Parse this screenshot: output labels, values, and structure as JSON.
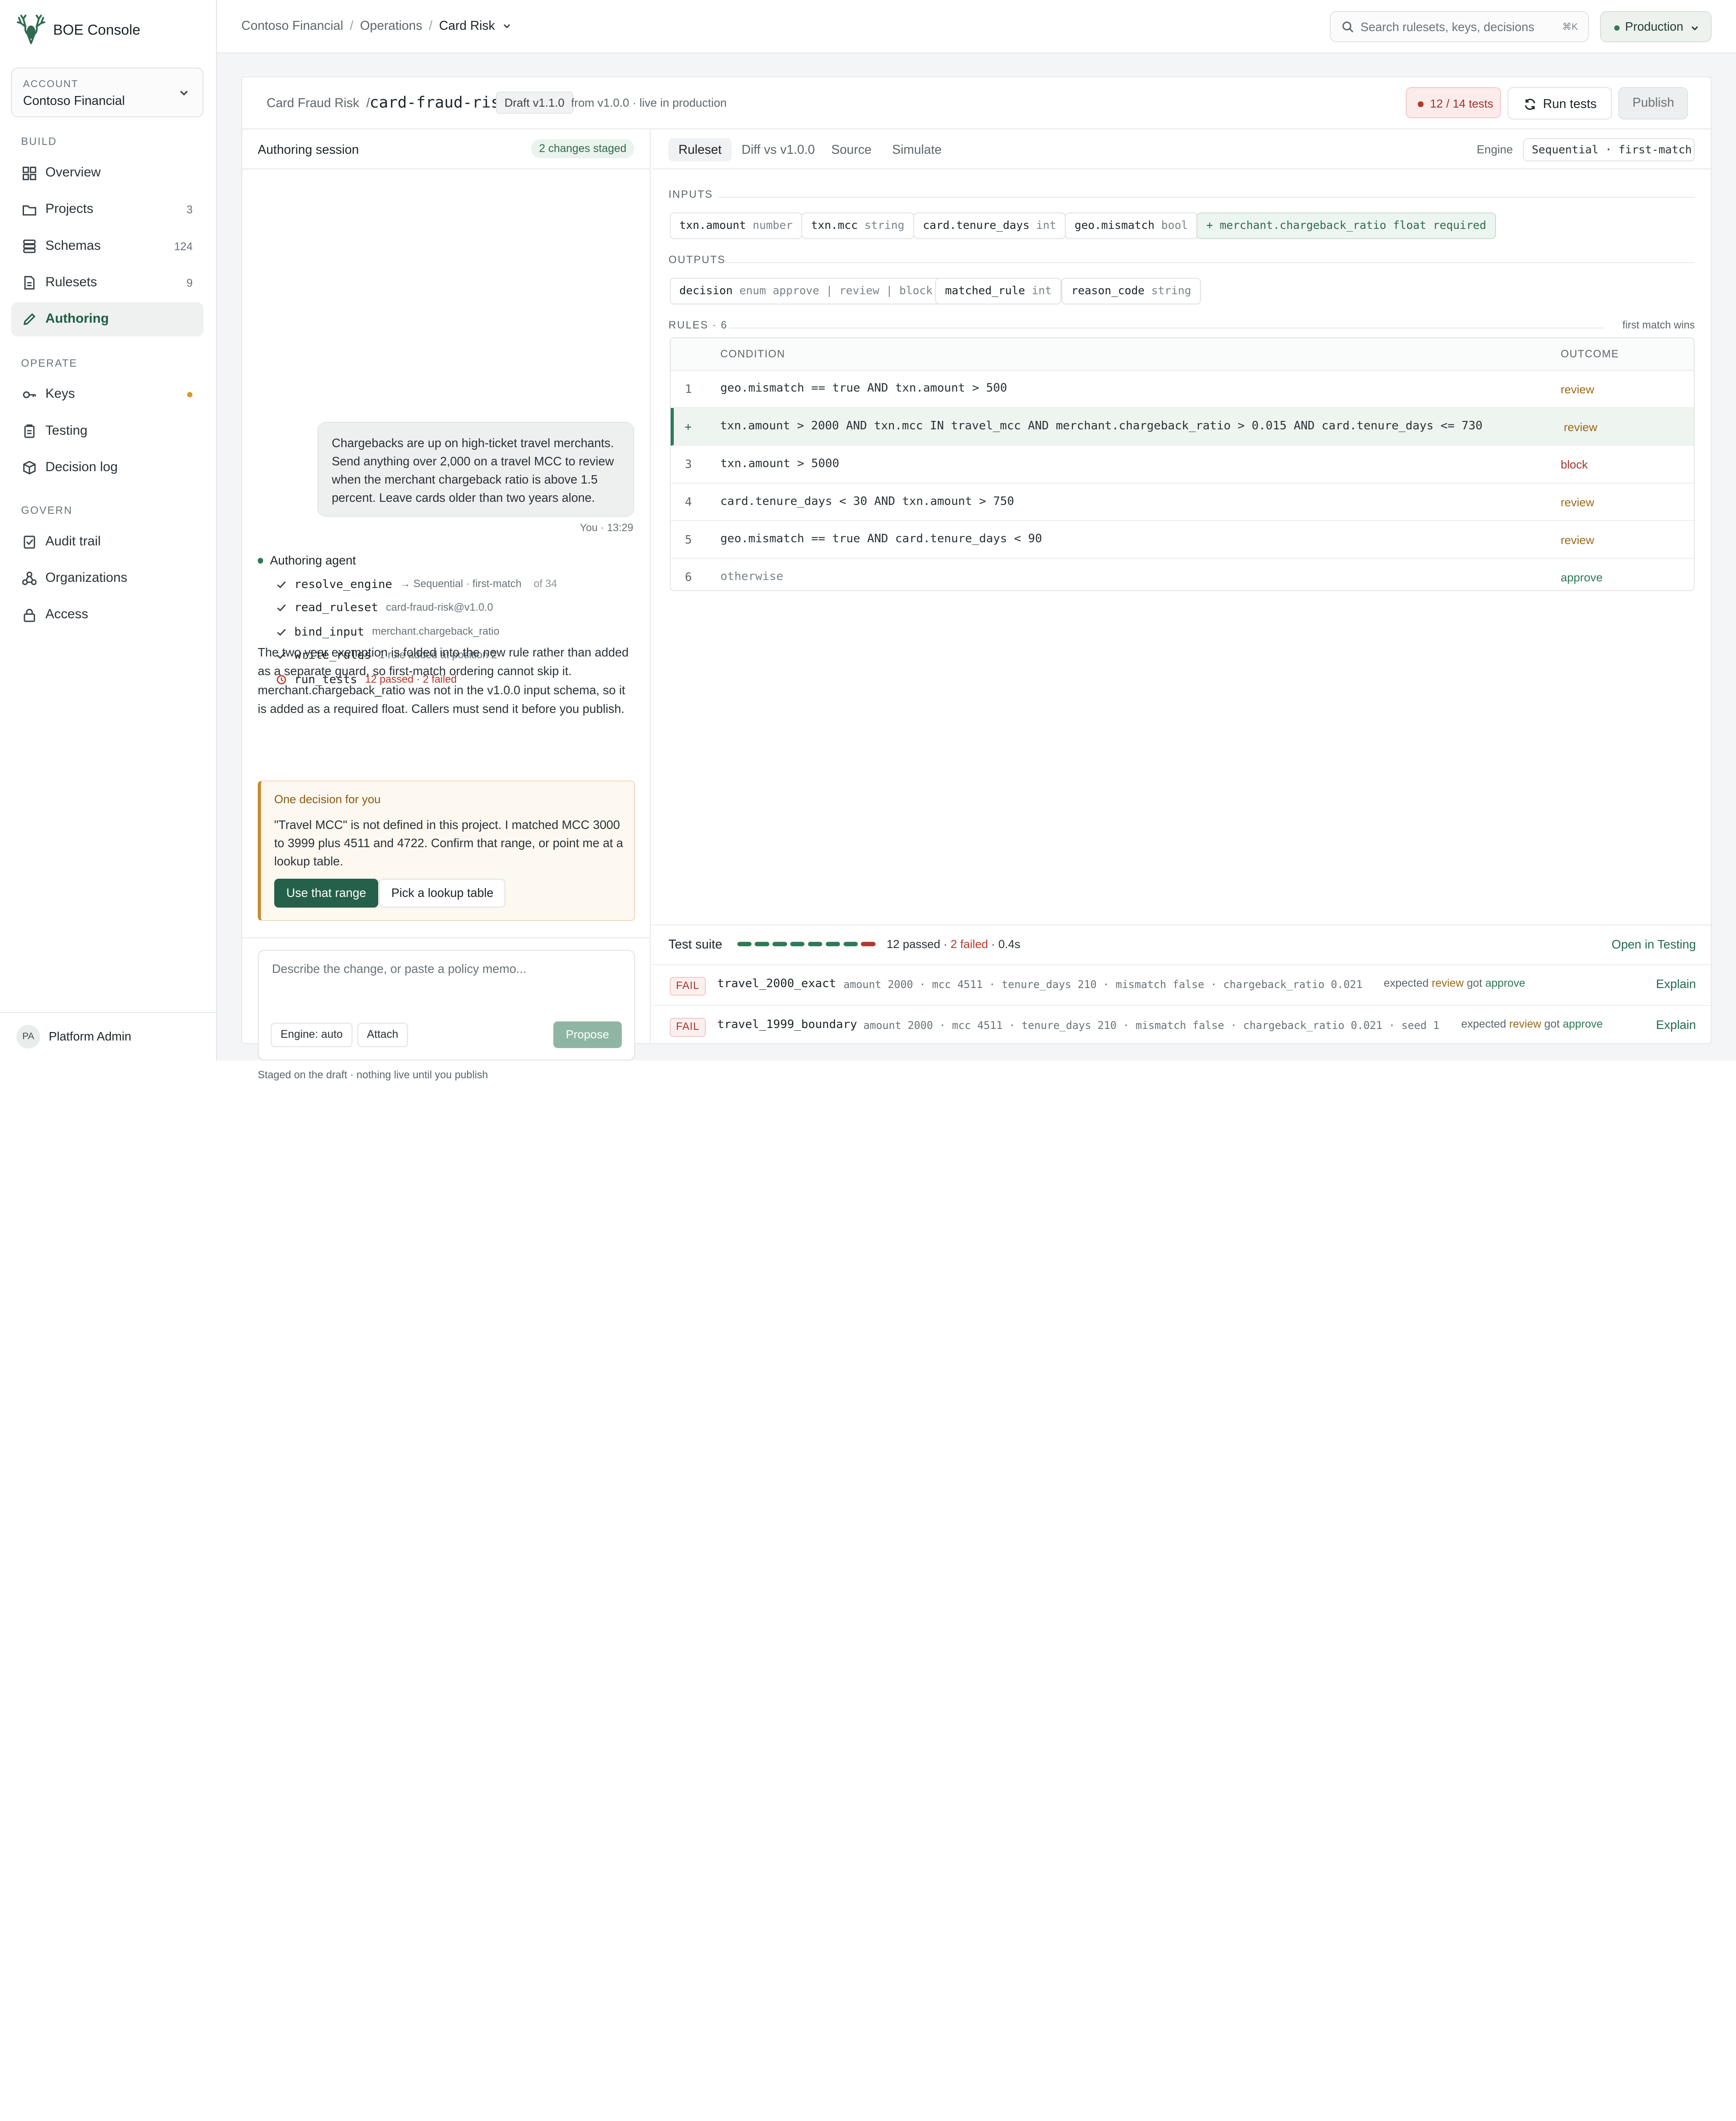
{
  "sidebar": {
    "brand": "BOE Console",
    "account": {
      "label": "ACCOUNT",
      "value": "Contoso Financial"
    },
    "sections": {
      "build": "BUILD",
      "operate": "OPERATE",
      "govern": "GOVERN"
    },
    "items": {
      "overview": {
        "label": "Overview",
        "icon": "grid-icon"
      },
      "projects": {
        "label": "Projects",
        "count": "3",
        "icon": "folder-icon"
      },
      "schemas": {
        "label": "Schemas",
        "count": "124",
        "icon": "database-icon"
      },
      "rulesets": {
        "label": "Rulesets",
        "count": "9",
        "icon": "document-icon"
      },
      "authoring": {
        "label": "Authoring",
        "icon": "pencil-icon"
      },
      "keys": {
        "label": "Keys",
        "icon": "key-icon"
      },
      "testing": {
        "label": "Testing",
        "icon": "clipboard-icon"
      },
      "decision_log": {
        "label": "Decision log",
        "icon": "cube-icon"
      },
      "audit_trail": {
        "label": "Audit trail",
        "icon": "checklist-icon"
      },
      "organizations": {
        "label": "Organizations",
        "icon": "org-icon"
      },
      "access": {
        "label": "Access",
        "icon": "lock-icon"
      }
    },
    "user": {
      "initials": "PA",
      "name": "Platform Admin"
    }
  },
  "topbar": {
    "breadcrumb": [
      "Contoso Financial",
      "Operations",
      "Card Risk"
    ],
    "search_placeholder": "Search rulesets, keys, decisions",
    "search_shortcut": "⌘K",
    "environment": "Production"
  },
  "header": {
    "project": "Card Fraud Risk",
    "slug": "card-fraud-risk",
    "draft": "Draft v1.1.0",
    "from": "from v1.0.0 · live in production",
    "tests_badge": "12 / 14 tests",
    "run_tests": "Run tests",
    "publish": "Publish"
  },
  "session": {
    "title": "Authoring session",
    "staged_badge": "2 changes staged",
    "user_message": "Chargebacks are up on high-ticket travel merchants. Send anything over 2,000 on a travel MCC to review when the merchant chargeback ratio is above 1.5 percent. Leave cards older than two years alone.",
    "user_time": "You · 13:29",
    "agent_name": "Authoring agent",
    "tools": [
      {
        "name": "resolve_engine",
        "detail": "→ Sequential · first-match",
        "extra": "of 34",
        "status": "ok"
      },
      {
        "name": "read_ruleset",
        "detail": "card-fraud-risk@v1.0.0",
        "extra": "",
        "status": "ok"
      },
      {
        "name": "bind_input",
        "detail": "merchant.chargeback_ratio",
        "extra": "",
        "status": "ok"
      },
      {
        "name": "write_rules",
        "detail": "1 rule added at position 2",
        "extra": "",
        "status": "ok"
      },
      {
        "name": "run_tests",
        "detail": "12 passed · 2 failed",
        "extra": "",
        "status": "warn"
      }
    ],
    "agent_text": "The two year exemption is folded into the new rule rather than added as a separate guard, so first-match ordering cannot skip it. merchant.chargeback_ratio was not in the v1.0.0 input schema, so it is added as a required float. Callers must send it before you publish.",
    "decision": {
      "title": "One decision for you",
      "body": "\"Travel MCC\" is not defined in this project. I matched MCC 3000 to 3999 plus 4511 and 4722. Confirm that range, or point me at a lookup table.",
      "primary": "Use that range",
      "secondary": "Pick a lookup table"
    },
    "composer": {
      "placeholder": "Describe the change, or paste a policy memo...",
      "engine_chip": "Engine: auto",
      "attach": "Attach",
      "propose": "Propose"
    },
    "footer_note": "Staged on the draft · nothing live until you publish"
  },
  "editor": {
    "tabs": [
      "Ruleset",
      "Diff vs v1.0.0",
      "Source",
      "Simulate"
    ],
    "engine_label": "Engine",
    "engine_value": "Sequential · first-match",
    "inputs_title": "INPUTS",
    "inputs": [
      {
        "name": "txn.amount",
        "type": "number",
        "added": false
      },
      {
        "name": "txn.mcc",
        "type": "string",
        "added": false
      },
      {
        "name": "card.tenure_days",
        "type": "int",
        "added": false
      },
      {
        "name": "geo.mismatch",
        "type": "bool",
        "added": false
      },
      {
        "name": "+ merchant.chargeback_ratio",
        "type": "float required",
        "added": true
      }
    ],
    "outputs_title": "OUTPUTS",
    "outputs": [
      {
        "name": "decision",
        "type": "enum approve | review | block"
      },
      {
        "name": "matched_rule",
        "type": "int"
      },
      {
        "name": "reason_code",
        "type": "string"
      }
    ],
    "rules_title": "RULES · 6",
    "rules_note": "first match wins",
    "rules_header": {
      "condition": "CONDITION",
      "outcome": "OUTCOME"
    },
    "rules": [
      {
        "no": "1",
        "condition": "geo.mismatch == true AND txn.amount > 500",
        "outcome": "review",
        "kind": "review",
        "added": false
      },
      {
        "no": "+",
        "condition": "txn.amount > 2000 AND txn.mcc IN travel_mcc AND merchant.chargeback_ratio > 0.015 AND card.tenure_days <= 730",
        "outcome": "review",
        "kind": "review",
        "added": true
      },
      {
        "no": "3",
        "condition": "txn.amount > 5000",
        "outcome": "block",
        "kind": "block",
        "added": false
      },
      {
        "no": "4",
        "condition": "card.tenure_days < 30 AND txn.amount > 750",
        "outcome": "review",
        "kind": "review",
        "added": false
      },
      {
        "no": "5",
        "condition": "geo.mismatch == true AND card.tenure_days < 90",
        "outcome": "review",
        "kind": "review",
        "added": false
      },
      {
        "no": "6",
        "condition": "otherwise",
        "outcome": "approve",
        "kind": "approve",
        "added": false
      }
    ]
  },
  "suite": {
    "title": "Test suite",
    "results": [
      "pass",
      "pass",
      "pass",
      "pass",
      "pass",
      "pass",
      "pass",
      "fail"
    ],
    "passed": "12 passed",
    "failed": "2 failed",
    "duration": "0.4s",
    "open_link": "Open in Testing",
    "failures": [
      {
        "status": "FAIL",
        "name": "travel_2000_exact",
        "args": "amount 2000 · mcc 4511 · tenure_days 210 · mismatch false · chargeback_ratio 0.021",
        "expected": "review",
        "got": "approve",
        "action": "Explain"
      },
      {
        "status": "FAIL",
        "name": "travel_1999_boundary",
        "args": "amount 2000 · mcc 4511 · tenure_days 210 · mismatch false · chargeback_ratio 0.021 · seed 1",
        "expected": "review",
        "got": "approve",
        "action": "Explain"
      }
    ]
  }
}
